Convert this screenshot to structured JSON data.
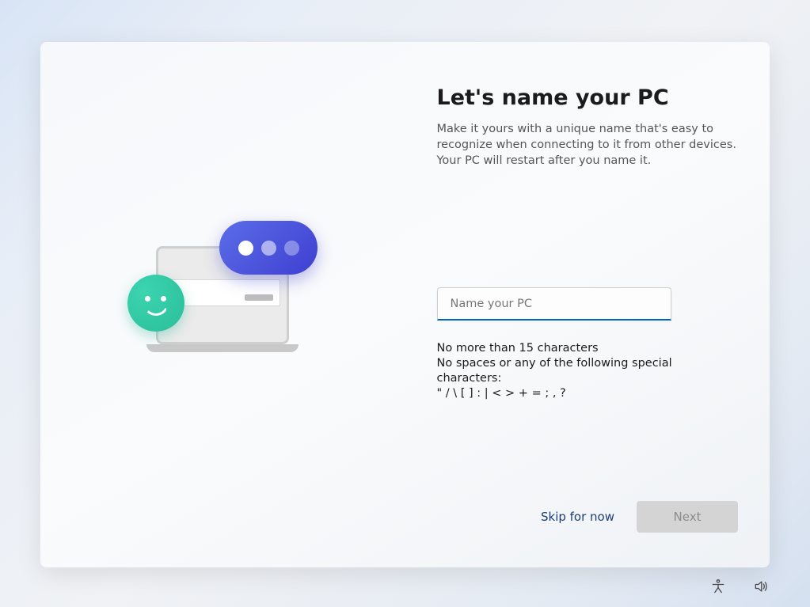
{
  "heading": "Let's name your PC",
  "description": "Make it yours with a unique name that's easy to recognize when connecting to it from other devices. Your PC will restart after you name it.",
  "input": {
    "placeholder": "Name your PC",
    "value": ""
  },
  "rules": {
    "line1": "No more than 15 characters",
    "line2": "No spaces or any of the following special characters:",
    "line3": "\" / \\ [ ] : | < > + = ; , ?"
  },
  "buttons": {
    "skip": "Skip for now",
    "next": "Next"
  },
  "tray": {
    "accessibility": "accessibility-icon",
    "volume": "volume-icon"
  }
}
